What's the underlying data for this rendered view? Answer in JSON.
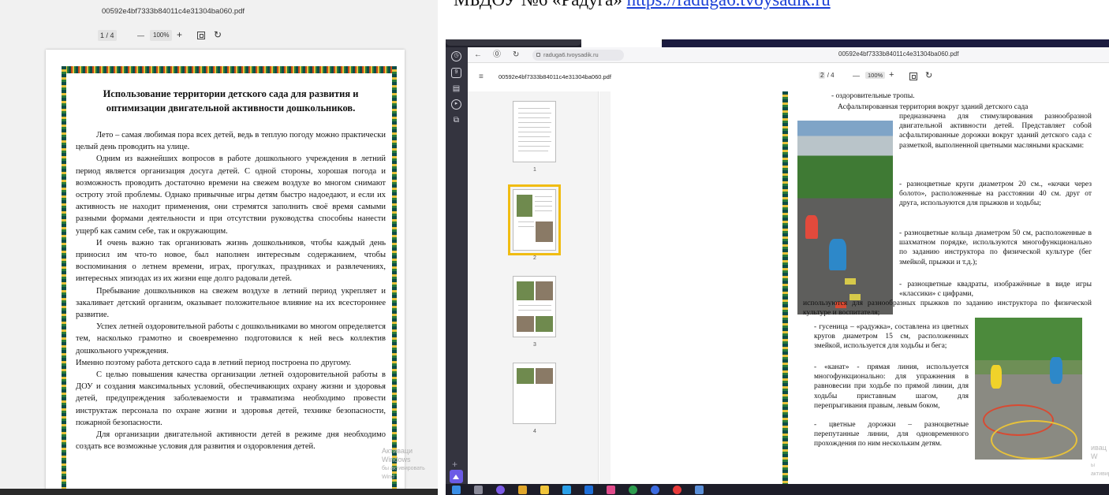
{
  "caption": {
    "prefix": "МБДОУ №6 «Радуга»",
    "link": "https://raduga6.tvoysadik.ru"
  },
  "left_viewer": {
    "filename": "00592e4bf7333b84011c4e31304ba060.pdf",
    "page_indicator": "1 / 4",
    "zoom_out": "—",
    "zoom": "100%",
    "zoom_in": "+",
    "fit_icon": "fit-page-icon",
    "rotate_icon": "rotate-icon",
    "document": {
      "title_line1": "Использование территории детского сада для развития и",
      "title_line2": "оптимизации двигательной активности дошкольников.",
      "paragraphs": [
        "Лето – самая любимая пора всех детей, ведь в теплую погоду можно практически целый день проводить на улице.",
        "Одним из важнейших вопросов в работе дошкольного учреждения в летний период является организация досуга детей. С одной стороны, хорошая погода и возможность проводить достаточно времени на свежем воздухе во многом снимают остроту этой проблемы. Однако привычные игры детям быстро надоедают, и если их активность не находит применения, они стремятся заполнить своё время самыми разными формами деятельности и при отсутствии руководства способны нанести ущерб как самим себе, так и окружающим.",
        "И очень важно так организовать жизнь дошкольников, чтобы каждый день приносил им что-то новое, был наполнен интересным содержанием, чтобы воспоминания о летнем времени, играх, прогулках, праздниках и развлечениях, интересных эпизодах из их жизни еще долго радовали детей.",
        "Пребывание дошкольников на свежем воздухе в летний период укрепляет и закаливает детский организм, оказывает положительное влияние на их всестороннее развитие.",
        "Успех летней оздоровительной работы с дошкольниками во многом определяется тем, насколько грамотно и своевременно подготовился к ней весь коллектив дошкольного учреждения.",
        "Именно поэтому работа детского сада в летний период построена по другому.",
        "С целью повышения качества организации летней оздоровительной работы в ДОУ и создания максимальных условий, обеспечивающих охрану жизни и здоровья детей, предупреждения заболеваемости и травматизма необходимо провести инструктаж персонала по охране жизни и здоровья детей, технике безопасности, пожарной безопасности.",
        "Для организации двигательной активности детей в режиме дня необходимо создать все возможные условия для развития и оздоровления детей."
      ]
    },
    "watermark_line1": "Активаци Windows",
    "watermark_line2": "бы активировать Wind"
  },
  "right_browser": {
    "address": "raduga6.tvoysadik.ru",
    "tab_title": "00592e4bf7333b84011c4e31304ba060.pdf",
    "pdf_name": "00592e4bf7333b84011c4e31304ba060.pdf",
    "page_current": "2",
    "page_total": "/ 4",
    "zoom_out": "—",
    "zoom": "100%",
    "zoom_in": "+",
    "thumbnails": [
      "1",
      "2",
      "3",
      "4"
    ],
    "selected_thumbnail": "2",
    "selected_color": "#f0bc12",
    "page_text": {
      "line1": "- оздоровительные тропы.",
      "line2": "Асфальтированная территория вокруг зданий детского сада",
      "block1": "предназначена для стимулирования разнообразной двигательной активности детей. Представляет собой асфальтированные дорожки вокруг зданий детского сада с разметкой, выполненной цветными масляными красками:",
      "block2": "- разноцветные круги диаметром 20 см., «кочки через болото», расположенные на расстоянии 40 см. друг от друга, используются для прыжков и ходьбы;",
      "block3": "- разноцветные кольца диаметром 50 см, расположенные в шахматном порядке, используются многофункционально по заданию инструктора по физической культуре (бег змейкой, прыжки и т.д.);",
      "block4": "- разноцветные квадраты, изображённые в виде игры «классики» с цифрами,",
      "block5": "используются для разнообразных прыжков по заданию инструктора по физической культуре и воспитателя;",
      "block6": "- гусеница – «радужка», составлена из цветных кругов диаметром 15 см, расположенных змейкой, используется для ходьбы и бега;",
      "block7": "- «канат» - прямая линия, используется многофункционально: для упражнения в равновесии при ходьбе по прямой линии, для ходьбы приставным шагом, для перепрыгивания правым, левым боком,",
      "block8": "- цветные дорожки – разноцветные перепутанные линии, для одновременного прохождения по ним нескольким детям."
    },
    "watermark_line1": "ивац W",
    "watermark_line2": "ы активир",
    "sidebar_icons": [
      "history-icon",
      "tabs-icon",
      "notes-icon",
      "play-icon",
      "screenshot-icon"
    ]
  }
}
